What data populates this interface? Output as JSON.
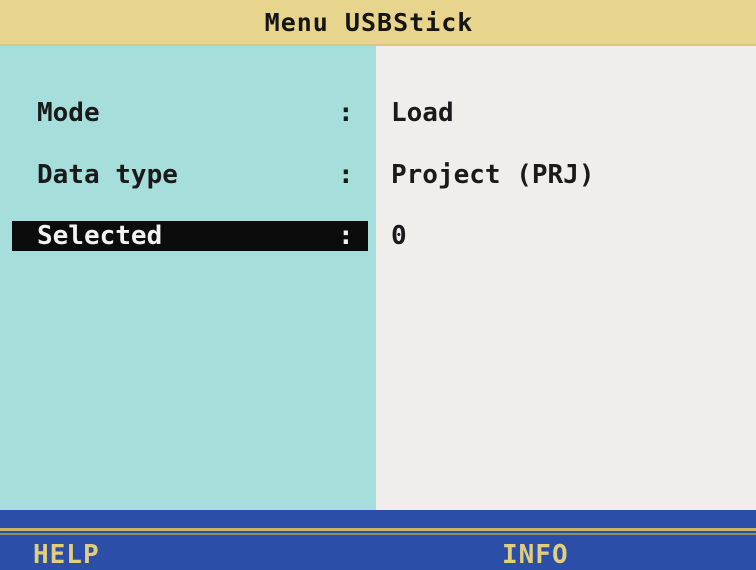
{
  "header": {
    "title": "Menu USBStick"
  },
  "menu": {
    "items": [
      {
        "label": "Mode",
        "colon": ":",
        "value": "Load"
      },
      {
        "label": "Data type",
        "colon": ":",
        "value": "Project (PRJ)"
      },
      {
        "label": "Selected",
        "colon": ":",
        "value": "0"
      }
    ],
    "selected_index": 2
  },
  "softkeys": {
    "help": "HELP",
    "info": "INFO"
  },
  "colors": {
    "title_bar": "#e7d58d",
    "label_pane": "#a6dedc",
    "value_pane": "#efeeeb",
    "selection": "#0c0c0c",
    "bottom_bar": "#2b4fa8",
    "softkey_text": "#e3cf7a"
  }
}
